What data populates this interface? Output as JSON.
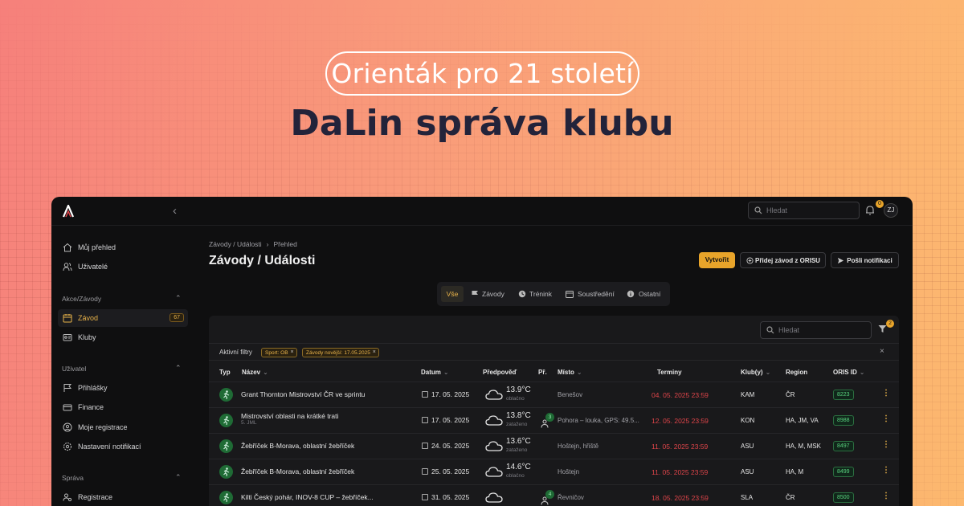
{
  "hero": {
    "tagline": "Orienták pro 21 století",
    "title": "DaLin správa klubu"
  },
  "topbar": {
    "search_placeholder": "Hledat",
    "notif_count": "0",
    "avatar": "ZJ"
  },
  "sidebar": {
    "main": [
      {
        "label": "Můj přehled"
      },
      {
        "label": "Uživatelé"
      }
    ],
    "section_akce": "Akce/Závody",
    "akce": [
      {
        "label": "Závod",
        "count": "67"
      },
      {
        "label": "Kluby"
      }
    ],
    "section_uzivatel": "Uživatel",
    "uzivatel": [
      {
        "label": "Přihlášky"
      },
      {
        "label": "Finance"
      },
      {
        "label": "Moje registrace"
      },
      {
        "label": "Nastavení notifikací"
      }
    ],
    "section_sprava": "Správa",
    "sprava": [
      {
        "label": "Registrace"
      }
    ]
  },
  "breadcrumb": {
    "part1": "Závody / Události",
    "part2": "Přehled"
  },
  "page_title": "Závody / Události",
  "actions": {
    "create": "Vytvořit",
    "add_orisu": "Přidej závod z ORISU",
    "send_notif": "Pošli notifikaci"
  },
  "tabs": [
    "Vše",
    "Závody",
    "Trénink",
    "Soustředění",
    "Ostatní"
  ],
  "table": {
    "search_placeholder": "Hledat",
    "filter_count": "2",
    "active_filters_label": "Aktivní filtry",
    "chips": [
      "Sport: OB",
      "Závody novější: 17.05.2025"
    ],
    "headers": {
      "typ": "Typ",
      "nazev": "Název",
      "datum": "Datum",
      "predpoved": "Předpověď",
      "pr": "Př.",
      "misto": "Místo",
      "terminy": "Terminy",
      "kluby": "Klub(y)",
      "region": "Region",
      "oris": "ORIS ID"
    },
    "rows": [
      {
        "name": "Grant Thornton Mistrovství ČR ve sprintu",
        "sub": "",
        "date": "17. 05. 2025",
        "temp": "13.9°C",
        "weather": "oblačno",
        "pr": "",
        "place": "Benešov",
        "deadline": "04. 05. 2025 23:59",
        "club": "KAM",
        "region": "ČR",
        "oris": "8223"
      },
      {
        "name": "Mistrovství oblasti na krátké trati",
        "sub": "5. JML",
        "date": "17. 05. 2025",
        "temp": "13.8°C",
        "weather": "zataženo",
        "pr": "3",
        "place": "Pohora – louka, GPS: 49.5...",
        "deadline": "12. 05. 2025 23:59",
        "club": "KON",
        "region": "HA, JM, VA",
        "oris": "8988"
      },
      {
        "name": "Žebříček B-Morava, oblastní žebříček",
        "sub": "",
        "date": "24. 05. 2025",
        "temp": "13.6°C",
        "weather": "zataženo",
        "pr": "",
        "place": "Hoštejn, hřiště",
        "deadline": "11. 05. 2025 23:59",
        "club": "ASU",
        "region": "HA, M, MSK",
        "oris": "8497"
      },
      {
        "name": "Žebříček B-Morava, oblastní žebříček",
        "sub": "",
        "date": "25. 05. 2025",
        "temp": "14.6°C",
        "weather": "oblačno",
        "pr": "",
        "place": "Hoštejn",
        "deadline": "11. 05. 2025 23:59",
        "club": "ASU",
        "region": "HA, M",
        "oris": "8499"
      },
      {
        "name": "Kilti Český pohár, INOV-8 CUP – žebříček...",
        "sub": "",
        "date": "31. 05. 2025",
        "temp": "",
        "weather": "",
        "pr": "4",
        "place": "Řevničov",
        "deadline": "18. 05. 2025 23:59",
        "club": "SLA",
        "region": "ČR",
        "oris": "8500"
      }
    ]
  },
  "colors": {
    "accent": "#e8a42a",
    "deadline": "#e0454a",
    "oris": "#59d17e"
  }
}
